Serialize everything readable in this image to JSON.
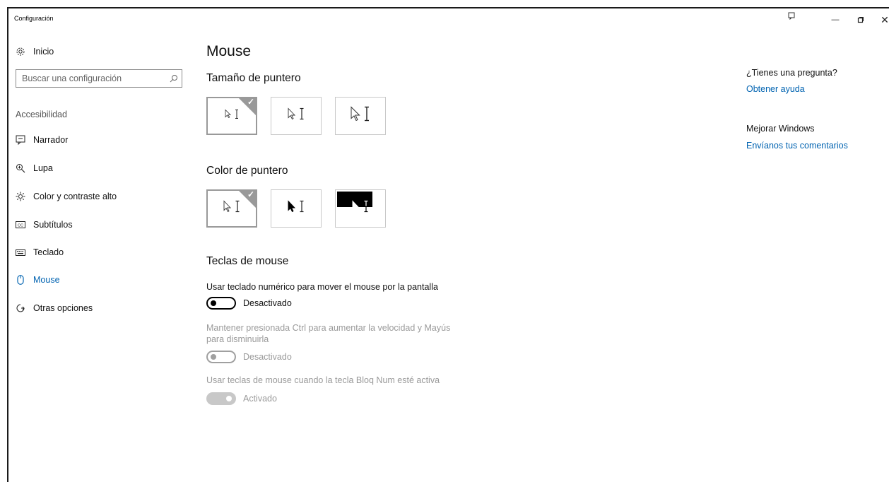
{
  "window": {
    "title": "Configuración"
  },
  "sidebar": {
    "home_label": "Inicio",
    "search": {
      "placeholder": "Buscar una configuración"
    },
    "group_label": "Accesibilidad",
    "items": [
      {
        "label": "Narrador",
        "icon": "narrator-icon"
      },
      {
        "label": "Lupa",
        "icon": "magnifier-icon"
      },
      {
        "label": "Color y contraste alto",
        "icon": "brightness-icon"
      },
      {
        "label": "Subtítulos",
        "icon": "captions-icon"
      },
      {
        "label": "Teclado",
        "icon": "keyboard-icon"
      },
      {
        "label": "Mouse",
        "icon": "mouse-icon",
        "active": true
      },
      {
        "label": "Otras opciones",
        "icon": "other-options-icon"
      }
    ]
  },
  "main": {
    "title": "Mouse",
    "pointer_size": {
      "heading": "Tamaño de puntero",
      "selected_index": 0
    },
    "pointer_color": {
      "heading": "Color de puntero",
      "selected_index": 0
    },
    "mouse_keys": {
      "heading": "Teclas de mouse",
      "setting1": {
        "label": "Usar teclado numérico para mover el mouse por la pantalla",
        "state": "Desactivado"
      },
      "setting2": {
        "label_line1": "Mantener presionada Ctrl para aumentar la velocidad y Mayús",
        "label_line2": "para disminuirla",
        "state": "Desactivado"
      },
      "setting3": {
        "label": "Usar teclas de mouse cuando la tecla Bloq Num esté activa",
        "state": "Activado"
      }
    }
  },
  "right_panel": {
    "question_heading": "¿Tienes una pregunta?",
    "help_link": "Obtener ayuda",
    "improve_heading": "Mejorar Windows",
    "feedback_link": "Envíanos tus comentarios"
  },
  "colors": {
    "accent": "#0063b1",
    "disabled": "#9a9a9a"
  }
}
